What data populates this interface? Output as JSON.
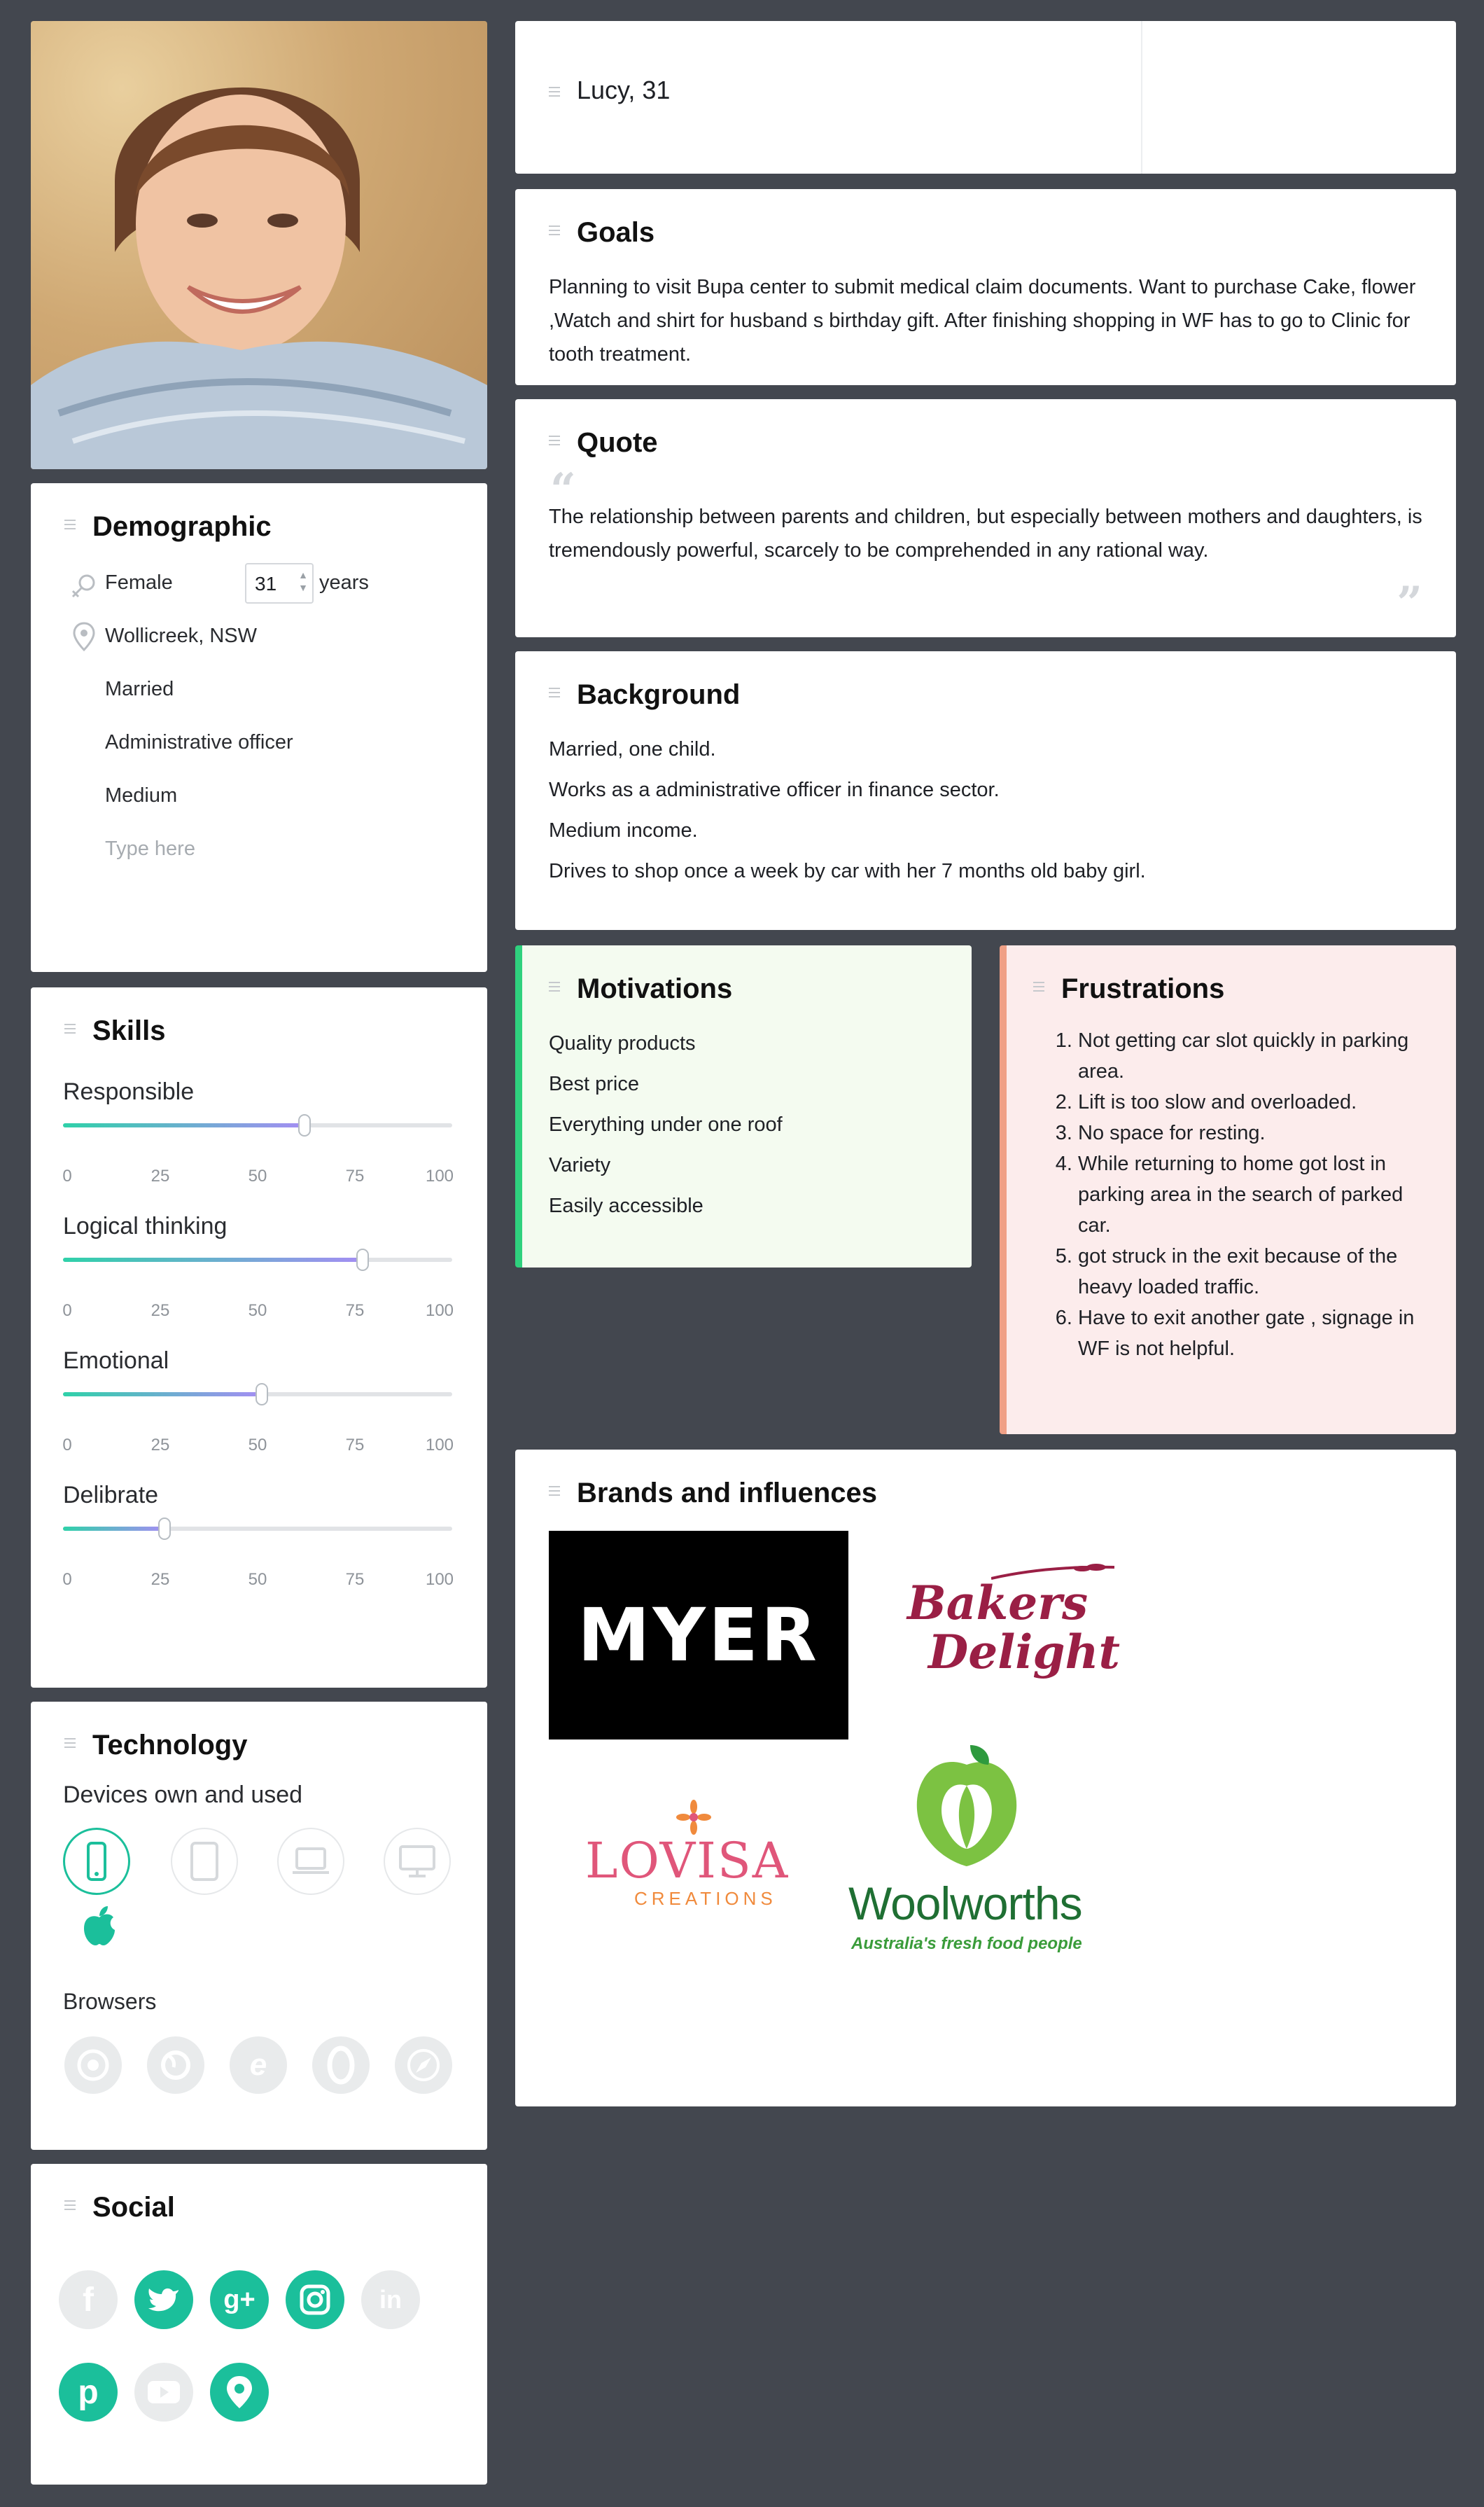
{
  "persona": {
    "name": "Lucy, 31"
  },
  "demographic": {
    "title": "Demographic",
    "gender": "Female",
    "age": "31",
    "age_unit": "years",
    "location": "Wollicreek, NSW",
    "status": "Married",
    "occupation": "Administrative officer",
    "income": "Medium",
    "placeholder": "Type here"
  },
  "skills": {
    "title": "Skills",
    "ticks": [
      "0",
      "25",
      "50",
      "75",
      "100"
    ],
    "items": [
      {
        "label": "Responsible",
        "value": 62
      },
      {
        "label": "Logical thinking",
        "value": 77
      },
      {
        "label": "Emotional",
        "value": 51
      },
      {
        "label": "Delibrate",
        "value": 26
      }
    ]
  },
  "technology": {
    "title": "Technology",
    "devices_label": "Devices own and used",
    "devices": [
      "phone-icon",
      "tablet-icon",
      "laptop-icon",
      "desktop-icon"
    ],
    "active_device": "phone-icon",
    "os": "apple-icon",
    "browsers_label": "Browsers",
    "browsers": [
      "chrome-icon",
      "firefox-icon",
      "ie-icon",
      "opera-icon",
      "safari-icon"
    ]
  },
  "social": {
    "title": "Social",
    "items": [
      {
        "icon": "facebook-icon",
        "active": false
      },
      {
        "icon": "twitter-icon",
        "active": true
      },
      {
        "icon": "google-plus-icon",
        "active": true
      },
      {
        "icon": "instagram-icon",
        "active": true
      },
      {
        "icon": "linkedin-icon",
        "active": false
      },
      {
        "icon": "pinterest-icon",
        "active": true
      },
      {
        "icon": "youtube-icon",
        "active": false
      },
      {
        "icon": "periscope-icon",
        "active": true
      }
    ]
  },
  "goals": {
    "title": "Goals",
    "text": "Planning to visit Bupa center to submit medical claim documents. Want to purchase Cake, flower ,Watch and shirt  for husband s birthday gift. After finishing shopping in WF has to go to Clinic for tooth treatment."
  },
  "quote": {
    "title": "Quote",
    "text": "The relationship between parents and children, but especially between mothers and daughters, is tremendously powerful, scarcely to be comprehended in any rational way."
  },
  "background": {
    "title": "Background",
    "lines": [
      "Married, one child.",
      "Works  as a administrative officer in finance sector.",
      "Medium income.",
      "Drives to shop once a week by car with her 7 months old baby girl."
    ]
  },
  "motivations": {
    "title": "Motivations",
    "items": [
      "Quality products",
      "Best price",
      "Everything under one roof",
      "Variety",
      "Easily accessible"
    ]
  },
  "frustrations": {
    "title": "Frustrations",
    "items": [
      "Not getting car slot quickly in parking area.",
      "Lift is too slow and overloaded.",
      "No space for resting.",
      "While returning to home got lost in parking area in the search of parked car.",
      "got struck in the exit because of the heavy loaded traffic.",
      "Have to exit another gate , signage in WF is not helpful."
    ]
  },
  "brands": {
    "title": "Brands and influences",
    "myer": "MYER",
    "bakers_line1": "Bakers",
    "bakers_line2": "Delight",
    "lovisa": "LOVISA",
    "lovisa_sub": "CREATIONS",
    "woolworths": "Woolworths",
    "woolworths_tag": "Australia's fresh food people"
  },
  "colors": {
    "accent": "#1bbf9b",
    "background": "#43474f",
    "motivations_bg": "#f4fbf0",
    "frustrations_bg": "#fcecec"
  }
}
